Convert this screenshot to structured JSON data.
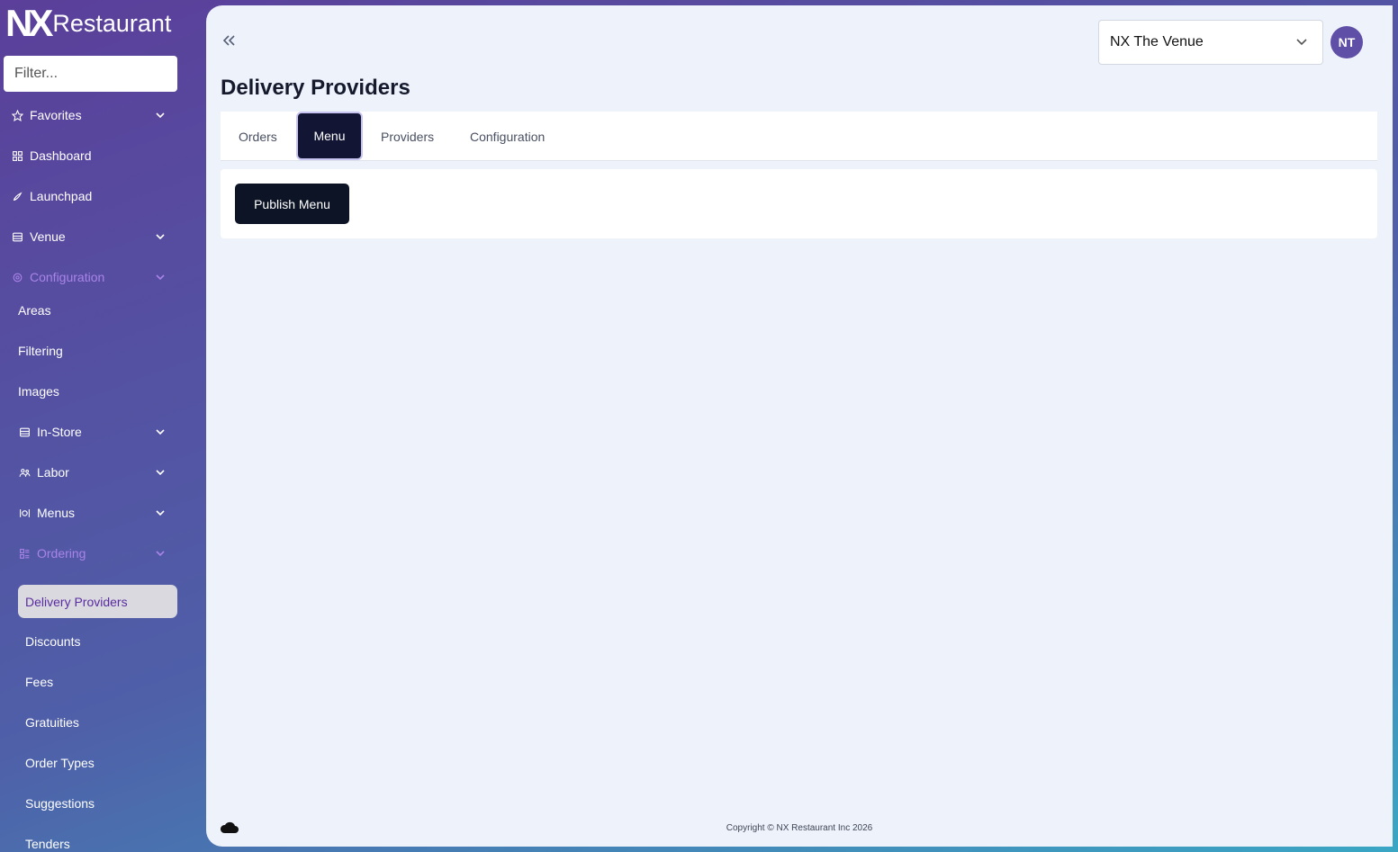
{
  "app": {
    "logo_mark": "NX",
    "logo_text": "Restaurant"
  },
  "sidebar": {
    "filter_placeholder": "Filter...",
    "items": {
      "favorites": "Favorites",
      "dashboard": "Dashboard",
      "launchpad": "Launchpad",
      "venue": "Venue",
      "configuration": "Configuration",
      "areas": "Areas",
      "filtering": "Filtering",
      "images": "Images",
      "in_store": "In-Store",
      "labor": "Labor",
      "menus": "Menus",
      "ordering": "Ordering",
      "delivery_providers": "Delivery Providers",
      "discounts": "Discounts",
      "fees": "Fees",
      "gratuities": "Gratuities",
      "order_types": "Order Types",
      "suggestions": "Suggestions",
      "tenders": "Tenders"
    }
  },
  "header": {
    "venue_selected": "NX The Venue",
    "avatar_initials": "NT"
  },
  "page": {
    "title": "Delivery Providers",
    "tabs": {
      "orders": "Orders",
      "menu": "Menu",
      "providers": "Providers",
      "configuration": "Configuration"
    },
    "active_tab": "Menu",
    "publish_label": "Publish Menu"
  },
  "footer": {
    "copyright": "Copyright © NX Restaurant Inc 2026"
  },
  "colors": {
    "accent_dark": "#121634",
    "active_nav_text": "#5a2ca0",
    "dim_nav_text": "#a984e8",
    "avatar_bg": "#5f4fa7"
  }
}
